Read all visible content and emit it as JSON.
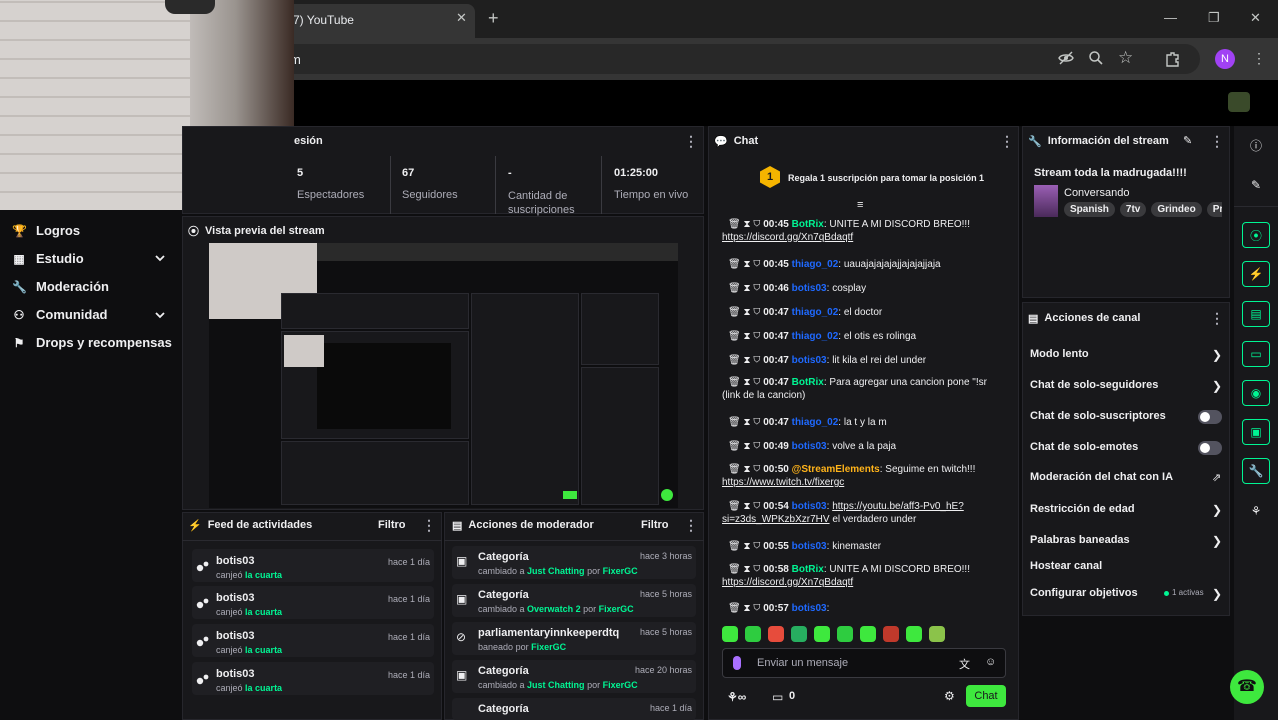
{
  "browser": {
    "tab_title": "7) YouTube",
    "url_fragment": "m",
    "profile_initial": "N"
  },
  "sidebar": {
    "items": [
      {
        "label": "Logros"
      },
      {
        "label": "Estudio"
      },
      {
        "label": "Moderación"
      },
      {
        "label": "Comunidad"
      },
      {
        "label": "Drops y recompensas"
      }
    ]
  },
  "session": {
    "title_fragment": "esión",
    "stats": [
      {
        "value": "5",
        "label": "Espectadores"
      },
      {
        "value": "67",
        "label": "Seguidores"
      },
      {
        "value": "-",
        "label": "Cantidad de suscripciones"
      },
      {
        "value": "01:25:00",
        "label": "Tiempo en vivo"
      }
    ]
  },
  "preview": {
    "title": "Vista previa del stream"
  },
  "feed": {
    "title": "Feed de actividades",
    "filter": "Filtro",
    "items": [
      {
        "user": "botis03",
        "action": "canjeó",
        "reward": "la cuarta",
        "time": "hace 1 día"
      },
      {
        "user": "botis03",
        "action": "canjeó",
        "reward": "la cuarta",
        "time": "hace 1 día"
      },
      {
        "user": "botis03",
        "action": "canjeó",
        "reward": "la cuarta",
        "time": "hace 1 día"
      },
      {
        "user": "botis03",
        "action": "canjeó",
        "reward": "la cuarta",
        "time": "hace 1 día"
      }
    ]
  },
  "mod": {
    "title": "Acciones de moderador",
    "filter": "Filtro",
    "items": [
      {
        "title": "Categoría",
        "pre": "cambiado a",
        "target": "Just Chatting",
        "by": "por",
        "mod": "FixerGC",
        "time": "hace 3 horas"
      },
      {
        "title": "Categoría",
        "pre": "cambiado a",
        "target": "Overwatch 2",
        "by": "por",
        "mod": "FixerGC",
        "time": "hace 5 horas"
      },
      {
        "title": "parliamentaryinnkeeperdtq",
        "pre": "baneado",
        "target": "",
        "by": "por",
        "mod": "FixerGC",
        "time": "hace 5 horas"
      },
      {
        "title": "Categoría",
        "pre": "cambiado a",
        "target": "Just Chatting",
        "by": "por",
        "mod": "FixerGC",
        "time": "hace 20 horas"
      },
      {
        "title": "Categoría",
        "pre": "",
        "target": "",
        "by": "",
        "mod": "",
        "time": "hace 1 día"
      }
    ]
  },
  "chat": {
    "title": "Chat",
    "gift_rank": "1",
    "gift_text": "Regala 1 suscripción para tomar la posición 1",
    "messages": [
      {
        "time": "00:45",
        "user": "BotRix",
        "msg": "UNITE A MI DISCORD BREO!!!",
        "link": "https://discord.gg/Xn7qBdaqtf"
      },
      {
        "time": "00:45",
        "user": "thiago_02",
        "msg": "uauajajajajajjajajajjaja"
      },
      {
        "time": "00:46",
        "user": "botis03",
        "msg": "cosplay"
      },
      {
        "time": "00:47",
        "user": "thiago_02",
        "msg": "el doctor"
      },
      {
        "time": "00:47",
        "user": "thiago_02",
        "msg": "el otis es rolinga"
      },
      {
        "time": "00:47",
        "user": "botis03",
        "msg": "lit kila el rei del under"
      },
      {
        "time": "00:47",
        "user": "BotRix",
        "msg": "Para agregar una cancion pone \"!sr (link de la cancion)"
      },
      {
        "time": "00:47",
        "user": "thiago_02",
        "msg": "la t y la m"
      },
      {
        "time": "00:49",
        "user": "botis03",
        "msg": "volve a la paja"
      },
      {
        "time": "00:50",
        "user": "@StreamElements",
        "msg": "Seguime en twitch!!!",
        "link": "https://www.twitch.tv/fixergc"
      },
      {
        "time": "00:54",
        "user": "botis03",
        "msg": "el verdadero under",
        "link": "https://youtu.be/aff3-Pv0_hE?si=z3ds_WPKzbXzr7HV"
      },
      {
        "time": "00:55",
        "user": "botis03",
        "msg": "kinemaster"
      },
      {
        "time": "00:58",
        "user": "BotRix",
        "msg": "UNITE A MI DISCORD BREO!!!",
        "link": "https://discord.gg/Xn7qBdaqtf"
      },
      {
        "time": "00:57",
        "user": "botis03",
        "msg": ""
      }
    ],
    "placeholder": "Enviar un mensaje",
    "points": "0",
    "send_label": "Chat"
  },
  "info": {
    "title": "Información del stream",
    "stream_title": "Stream toda la madrugada!!!!",
    "category": "Conversando",
    "tags": [
      "Spanish",
      "7tv",
      "Grindeo",
      "Pr"
    ]
  },
  "actions": {
    "title": "Acciones de canal",
    "items": [
      {
        "label": "Modo lento",
        "control": "arrow"
      },
      {
        "label": "Chat de solo-seguidores",
        "control": "arrow"
      },
      {
        "label": "Chat de solo-suscriptores",
        "control": "toggle"
      },
      {
        "label": "Chat de solo-emotes",
        "control": "toggle"
      },
      {
        "label": "Moderación del chat con IA",
        "control": "external"
      },
      {
        "label": "Restricción de edad",
        "control": "arrow"
      },
      {
        "label": "Palabras baneadas",
        "control": "arrow"
      },
      {
        "label": "Hostear canal",
        "control": "none"
      },
      {
        "label": "Configurar objetivos",
        "control": "arrow"
      }
    ],
    "goals_active": "1 activas"
  },
  "colors": {
    "accent_green": "#00f593",
    "send_green": "#3ee83e",
    "twitch_blue": "#1f69ff",
    "bg": "#0e0e10",
    "panel": "#18181b"
  }
}
